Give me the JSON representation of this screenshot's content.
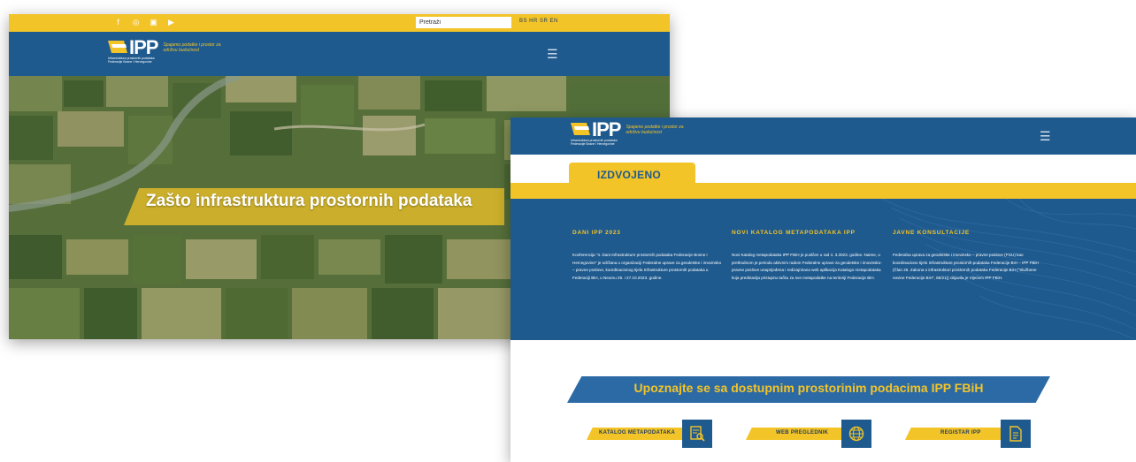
{
  "window1": {
    "social_icons": [
      "facebook-icon",
      "instagram-icon",
      "linkedin-icon",
      "youtube-icon"
    ],
    "search": {
      "value": "Pretraži"
    },
    "languages": "BS HR SR EN",
    "logo": {
      "mark": "IPP",
      "subtitle_line1": "Infrastruktura prostornih podataka",
      "subtitle_line2": "Federacije Bosne i Hercegovine",
      "tagline_line1": "Spajamo podatke i prostor za",
      "tagline_line2": "održivu budućnost"
    },
    "menu_icon": "☰",
    "hero_title": "Zašto infrastruktura prostornih podataka"
  },
  "window2": {
    "logo": {
      "mark": "IPP",
      "subtitle_line1": "Infrastruktura prostornih podataka",
      "subtitle_line2": "Federacije Bosne i Hercegovine",
      "tagline_line1": "Spajamo podatke i prostor za",
      "tagline_line2": "održivu budućnost"
    },
    "menu_icon": "☰",
    "featured_label": "IZDVOJENO",
    "news": [
      {
        "title": "DANI IPP 2023",
        "text": "Konferencija \"4. Dani Infrastrukture prostornih podataka Federacije Bosne i Hercegovine\" je održana u organizaciji Federalne uprave za geodetske i imovinsko – pravne poslove, koordinacionog tijela Infrastrukture prostornih podataka u Federaciji BiH, u Neumu 26. i 27.10.2023. godine."
      },
      {
        "title": "NOVI KATALOG METAPODATAKA IPP",
        "text": "Novi Katalog metapodataka IPP FBiH je puslčen u rad 4. 3.2023. godine. Naime, u prethodnom je periodu aktivnim radom Federalne uprave za geodetske i imovinsko-pravne poslove unaprijeđena i redizajnirana web aplikacija Katalogo metapodataka koja predstavlja pristupnu tačku za sve metapodatke na teritoriji Federacije BiH."
      },
      {
        "title": "JAVNE KONSULTACIJE",
        "text": "Federalna uprava za geodetske i imovinsko – pravne poslove (FGU) kao koordinaciono tijelo Infrastrukture prostornih podataka Federacije BiH – IPP FBiH (Član 26. Zakona o infrastrukturi prostornih podataka Federacije BiH (\"Službene novine Federacije BiH\", 85/21)) objavila je Vijećem IPP FBiH."
      }
    ],
    "datasets_heading": "Upoznajte se sa dostupnim prostorinim podacima IPP FBiH",
    "buttons": [
      {
        "label": "KATALOG METAPODATAKA",
        "icon": "document-search-icon"
      },
      {
        "label": "WEB PREGLEDNIK",
        "icon": "globe-icon"
      },
      {
        "label": "REGISTAR IPP",
        "icon": "register-document-icon"
      }
    ]
  },
  "colors": {
    "brand_blue": "#1f5a8e",
    "accent_yellow": "#f3c428",
    "hero_green": "#4f6a35"
  }
}
